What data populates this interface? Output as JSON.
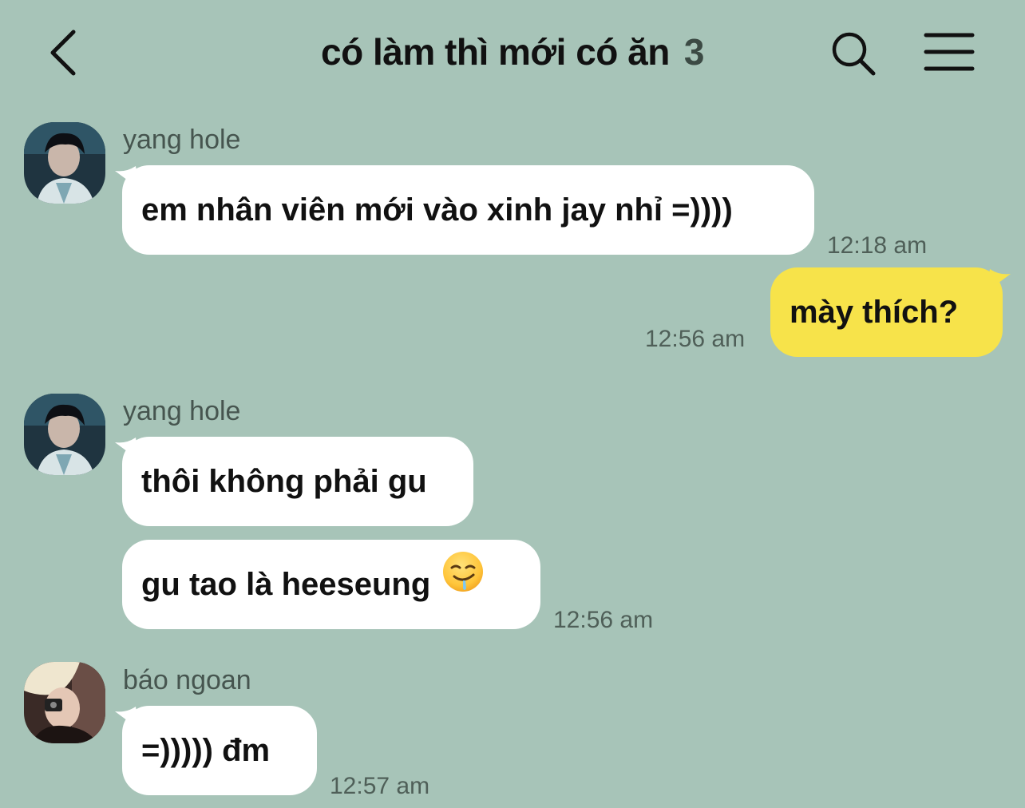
{
  "header": {
    "title": "có làm thì mới có ăn",
    "member_count": "3"
  },
  "messages": [
    {
      "sender": "yang hole",
      "text": "em nhân viên mới vào xinh jay nhỉ =))))",
      "time": "12:18 am"
    },
    {
      "sender": "me",
      "text": "mày thích?",
      "time": "12:56 am"
    },
    {
      "sender": "yang hole",
      "text": "thôi không phải gu"
    },
    {
      "sender": "yang hole",
      "text": "gu tao là heeseung",
      "emoji": "drooling-face-icon",
      "time": "12:56 am"
    },
    {
      "sender": "báo ngoan",
      "text": "=))))) đm",
      "time": "12:57 am"
    }
  ],
  "colors": {
    "background": "#a7c4b8",
    "my_bubble": "#f7e34a",
    "their_bubble": "#ffffff"
  }
}
